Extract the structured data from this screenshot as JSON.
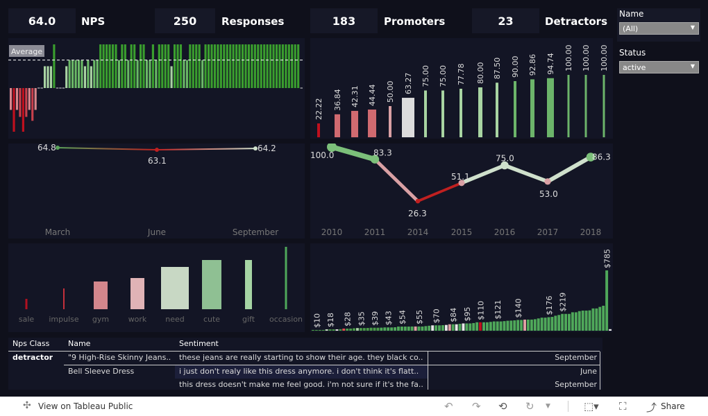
{
  "kpis": [
    {
      "value": "64.0",
      "label": "NPS"
    },
    {
      "value": "250",
      "label": "Responses"
    },
    {
      "value": "183",
      "label": "Promoters"
    },
    {
      "value": "23",
      "label": "Detractors"
    }
  ],
  "filters": {
    "name_label": "Name",
    "name_value": "(All)",
    "status_label": "Status",
    "status_value": "active"
  },
  "colors": {
    "promoter": "#3a9e2e",
    "detractor": "#c0101e",
    "neutral": "#d9d9d9",
    "panel": "#131525"
  },
  "chart_data": [
    {
      "type": "bar",
      "id": "nps-by-customer",
      "reference_line": "Average",
      "average": 64,
      "values": [
        -50,
        -100,
        -50,
        -66,
        -100,
        -66,
        -50,
        -75,
        -50,
        0,
        0,
        50,
        50,
        50,
        100,
        0,
        0,
        0,
        50,
        64,
        64,
        64,
        64,
        64,
        50,
        64,
        50,
        64,
        64,
        100,
        100,
        100,
        100,
        100,
        100,
        64,
        100,
        100,
        64,
        100,
        100,
        64,
        100,
        100,
        64,
        64,
        100,
        64,
        100,
        100,
        100,
        100,
        50,
        100,
        100,
        100,
        64,
        64,
        100,
        100,
        100,
        100,
        64,
        100,
        100,
        100,
        100,
        100,
        100,
        100,
        100,
        100,
        100,
        100,
        100,
        100,
        100,
        100,
        100,
        100,
        100,
        100,
        100,
        100,
        100,
        100,
        100,
        100,
        100,
        100,
        100,
        100,
        100,
        100,
        0
      ],
      "ylim": [
        -100,
        100
      ]
    },
    {
      "type": "bar",
      "id": "nps-by-segment",
      "values": [
        22.22,
        36.84,
        42.31,
        44.44,
        50.0,
        63.27,
        75.0,
        75.0,
        77.78,
        80.0,
        87.5,
        90.0,
        92.86,
        94.74,
        100.0,
        100.0,
        100.0
      ],
      "labels": [
        "22.22",
        "36.84",
        "42.31",
        "44.44",
        "50.00",
        "63.27",
        "75.00",
        "75.00",
        "77.78",
        "80.00",
        "87.50",
        "90.00",
        "92.86",
        "94.74",
        "100.00",
        "100.00",
        "100.00"
      ],
      "ylim": [
        0,
        100
      ]
    },
    {
      "type": "line",
      "id": "nps-by-month",
      "categories": [
        "March",
        "June",
        "September"
      ],
      "values": [
        64.8,
        63.1,
        64.2
      ],
      "labels": [
        "64.8",
        "63.1",
        "64.2"
      ]
    },
    {
      "type": "line",
      "id": "nps-by-year",
      "categories": [
        "2010",
        "2011",
        "2014",
        "2015",
        "2016",
        "2017",
        "2018"
      ],
      "values": [
        100.0,
        83.3,
        26.3,
        51.1,
        75.0,
        53.0,
        86.3
      ],
      "labels": [
        "100.0",
        "83.3",
        "26.3",
        "51.1",
        "75.0",
        "53.0",
        "86.3"
      ],
      "ylim": [
        0,
        100
      ]
    },
    {
      "type": "bar",
      "id": "nps-by-reason",
      "categories": [
        "sale",
        "impulse",
        "gym",
        "work",
        "need",
        "cute",
        "gift",
        "occasion"
      ],
      "values": [
        15,
        30,
        40,
        45,
        61,
        71,
        71,
        90
      ],
      "colors": [
        "#b01020",
        "#c4303c",
        "#d3868c",
        "#e0b3b6",
        "#c8d8c4",
        "#8fc093",
        "#a6d4a4",
        "#4fa85a"
      ]
    },
    {
      "type": "bar",
      "id": "nps-by-price",
      "values": [
        10,
        10,
        10,
        10,
        18,
        18,
        18,
        18,
        20,
        28,
        28,
        28,
        32,
        35,
        35,
        35,
        36,
        39,
        39,
        39,
        40,
        43,
        43,
        43,
        45,
        54,
        54,
        54,
        54,
        55,
        55,
        55,
        55,
        60,
        65,
        70,
        70,
        70,
        72,
        75,
        84,
        84,
        84,
        90,
        95,
        95,
        95,
        100,
        110,
        110,
        110,
        110,
        115,
        121,
        121,
        121,
        125,
        130,
        132,
        135,
        140,
        140,
        145,
        145,
        145,
        150,
        160,
        170,
        170,
        176,
        180,
        195,
        205,
        219,
        219,
        219,
        240,
        240,
        255,
        262,
        262,
        265,
        290,
        290,
        310,
        325,
        785,
        20
      ],
      "labels": {
        "1": "$10",
        "5": "$18",
        "10": "$28",
        "14": "$35",
        "18": "$39",
        "22": "$43",
        "26": "$54",
        "31": "$55",
        "36": "$70",
        "41": "$84",
        "45": "$95",
        "49": "$110",
        "54": "$121",
        "60": "$140",
        "69": "$176",
        "73": "$219",
        "86": "$785"
      },
      "bar_colors": {
        "4": "#c8e0c4",
        "7": "#e8e8e8",
        "9": "#e05050",
        "13": "#a8d0a4",
        "30": "#e0a0a4",
        "35": "#e8e8e8",
        "39": "#e8e8e8",
        "40": "#e0a0a4",
        "42": "#e8e8e8",
        "44": "#e8e8e8",
        "49": "#c0101e",
        "62": "#e0a0a4",
        "87": "#e8e8e8"
      }
    }
  ],
  "table": {
    "headers": [
      "Nps Class",
      "Name",
      "Sentiment"
    ],
    "rows": [
      {
        "class": "detractor",
        "name": "\"9 High-Rise Skinny Jeans..",
        "sentiment": "these jeans are really starting to show their age. they black co..",
        "month": "September"
      },
      {
        "class": "",
        "name": "Bell Sleeve Dress",
        "sentiment": "i just don't realy like this dress anymore. i don't think it's flatt..",
        "month": "June"
      },
      {
        "class": "",
        "name": "",
        "sentiment": "this dress doesn't make me feel good. i'm not sure if it's the fa..",
        "month": "September"
      }
    ]
  },
  "footer": {
    "view_link": "View on Tableau Public",
    "share": "Share"
  }
}
